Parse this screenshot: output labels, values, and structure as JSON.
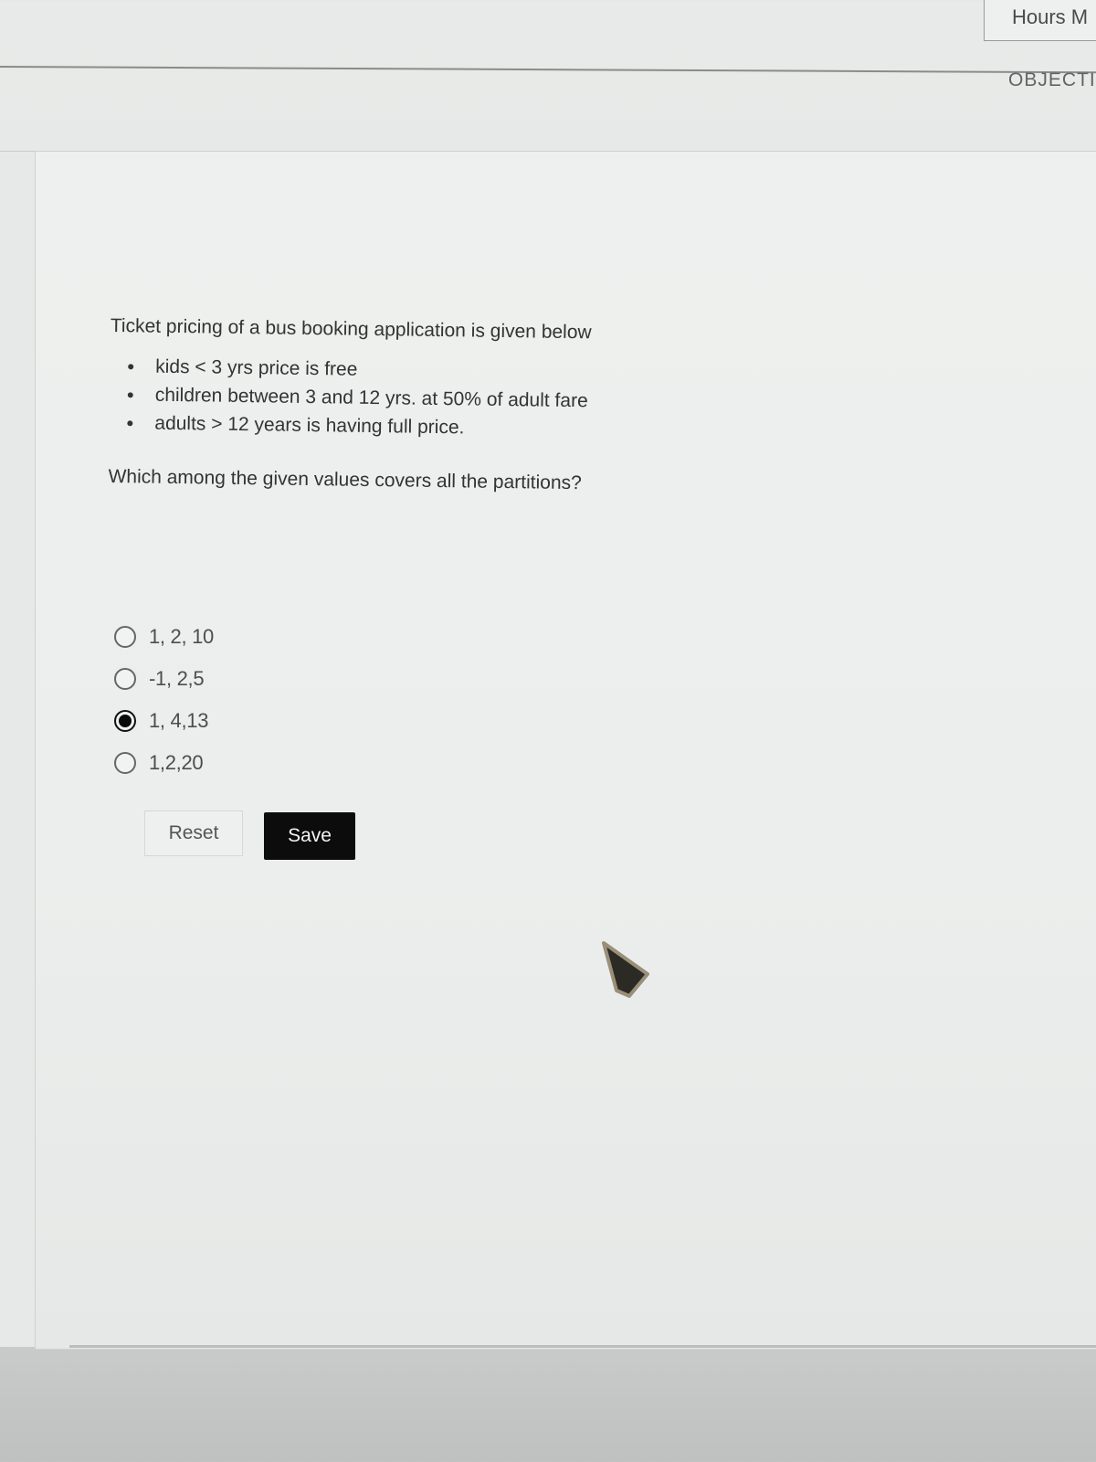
{
  "header": {
    "hours_label": "Hours M",
    "objective_tab": "OBJECTIV"
  },
  "question": {
    "intro": "Ticket pricing of a bus booking application is given below",
    "rules": [
      "kids < 3 yrs price is free",
      "children  between 3 and 12 yrs. at 50% of adult fare",
      "adults > 12 years is having full price."
    ],
    "prompt": "Which among the given values covers all the partitions?"
  },
  "options": [
    {
      "label": "1, 2, 10",
      "selected": false
    },
    {
      "label": "-1, 2,5",
      "selected": false
    },
    {
      "label": "1, 4,13",
      "selected": true
    },
    {
      "label": "1,2,20",
      "selected": false
    }
  ],
  "buttons": {
    "reset_label": "Reset",
    "save_label": "Save"
  },
  "icons": {
    "pointer": "mouse-pointer-icon"
  },
  "colors": {
    "save_bg": "#0c0c0c",
    "save_text": "#f4f4f4",
    "selected_radio": "#0a0a0a"
  }
}
